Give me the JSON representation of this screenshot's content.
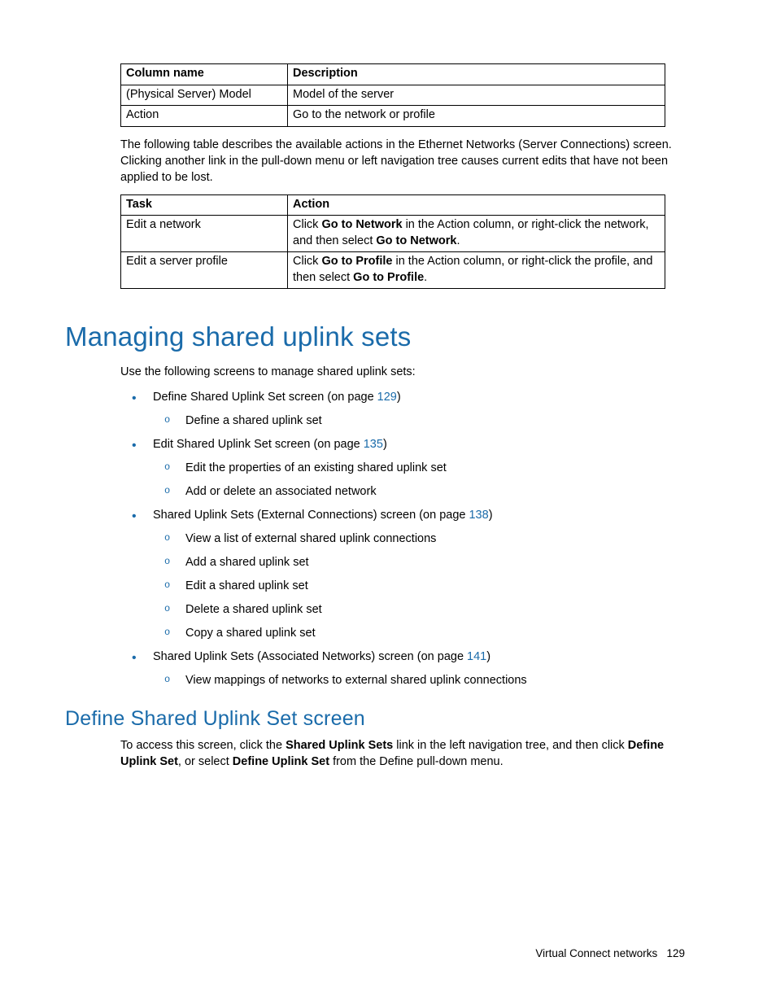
{
  "table1": {
    "headers": {
      "c1": "Column name",
      "c2": "Description"
    },
    "rows": [
      {
        "c1": "(Physical Server) Model",
        "c2": "Model of the server"
      },
      {
        "c1": "Action",
        "c2": "Go to the network or profile"
      }
    ]
  },
  "para1": "The following table describes the available actions in the Ethernet Networks (Server Connections) screen. Clicking another link in the pull-down menu or left navigation tree causes current edits that have not been applied to be lost.",
  "table2": {
    "headers": {
      "c1": "Task",
      "c2": "Action"
    },
    "rows": [
      {
        "c1": "Edit a network",
        "c2_a": "Click ",
        "c2_b": "Go to Network",
        "c2_c": " in the Action column, or right-click the network, and then select ",
        "c2_d": "Go to Network",
        "c2_e": "."
      },
      {
        "c1": "Edit a server profile",
        "c2_a": "Click ",
        "c2_b": "Go to Profile",
        "c2_c": " in the Action column, or right-click the profile, and then select ",
        "c2_d": "Go to Profile",
        "c2_e": "."
      }
    ]
  },
  "h1": "Managing shared uplink sets",
  "intro": "Use the following screens to manage shared uplink sets:",
  "list": {
    "item1": {
      "prefix": "Define Shared Uplink Set screen (on page ",
      "link": "129",
      "suffix": ")",
      "sub": [
        "Define a shared uplink set"
      ]
    },
    "item2": {
      "prefix": "Edit Shared Uplink Set screen (on page ",
      "link": "135",
      "suffix": ")",
      "sub": [
        "Edit the properties of an existing shared uplink set",
        "Add or delete an associated network"
      ]
    },
    "item3": {
      "prefix": "Shared Uplink Sets (External Connections) screen (on page ",
      "link": "138",
      "suffix": ")",
      "sub": [
        "View a list of external shared uplink connections",
        "Add a shared uplink set",
        "Edit a shared uplink set",
        "Delete a shared uplink set",
        "Copy a shared uplink set"
      ]
    },
    "item4": {
      "prefix": "Shared Uplink Sets (Associated Networks) screen (on page ",
      "link": "141",
      "suffix": ")",
      "sub": [
        "View mappings of networks to external shared uplink connections"
      ]
    }
  },
  "h2": "Define Shared Uplink Set screen",
  "para2": {
    "a": "To access this screen, click the ",
    "b": "Shared Uplink Sets",
    "c": " link in the left navigation tree, and then click ",
    "d": "Define Uplink Set",
    "e": ", or select ",
    "f": "Define Uplink Set",
    "g": " from the Define pull-down menu."
  },
  "footer": {
    "text": "Virtual Connect networks",
    "page": "129"
  }
}
